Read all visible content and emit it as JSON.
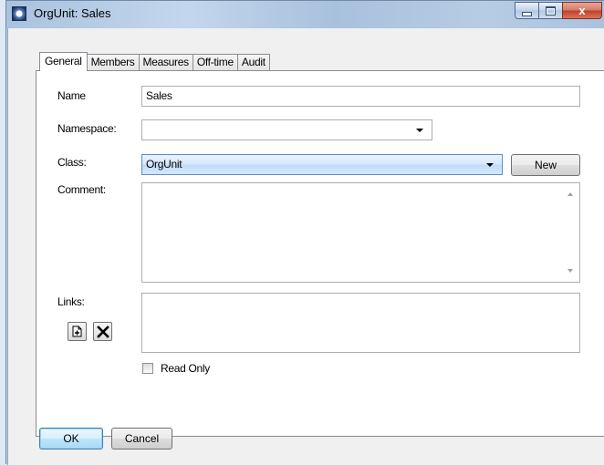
{
  "window": {
    "title": "OrgUnit: Sales",
    "controls": {
      "close_glyph": "x"
    }
  },
  "tabs": [
    "General",
    "Members",
    "Measures",
    "Off-time",
    "Audit"
  ],
  "form": {
    "name_label": "Name",
    "name_value": "Sales",
    "namespace_label": "Namespace:",
    "namespace_value": "",
    "class_label": "Class:",
    "class_value": "OrgUnit",
    "new_button": "New",
    "comment_label": "Comment:",
    "comment_value": "",
    "links_label": "Links:",
    "read_only_label": "Read Only",
    "read_only_checked": false
  },
  "footer": {
    "ok": "OK",
    "cancel": "Cancel"
  }
}
